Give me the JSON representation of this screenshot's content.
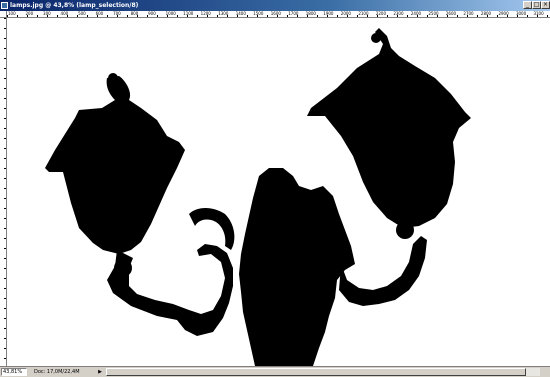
{
  "window": {
    "title": "lamps.jpg @ 43,8% (lamp_selection/8)",
    "controls": [
      "minimize",
      "maximize",
      "close"
    ]
  },
  "ruler": {
    "h_labels": [
      "100",
      "200",
      "300",
      "400",
      "500",
      "600",
      "700",
      "800",
      "900",
      "1000",
      "1100",
      "1200",
      "1300",
      "1400",
      "1500",
      "1600",
      "1700",
      "1800",
      "1900",
      "2000",
      "2100",
      "2200",
      "2300",
      "2400",
      "2500",
      "2600",
      "2700",
      "2800",
      "2900",
      "3000",
      "3100"
    ]
  },
  "canvas": {
    "background": "#ffffff",
    "mask_color": "#000000"
  },
  "status": {
    "zoom": "43,81%",
    "doc": "Doc: 17,0M/22,4M"
  },
  "icons": {
    "app": "photoshop-document-icon",
    "minimize": "minimize-icon",
    "maximize": "maximize-icon",
    "close": "close-icon",
    "arrow": "right-arrow-icon"
  }
}
